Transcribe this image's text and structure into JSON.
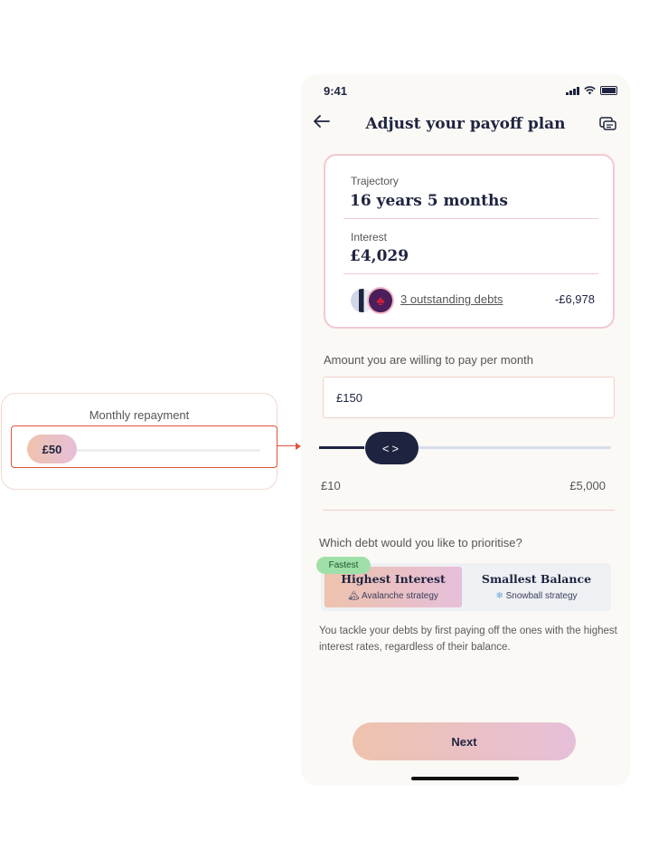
{
  "annotation": {
    "title": "Monthly repayment",
    "pill_value": "£50"
  },
  "status_bar": {
    "time": "9:41"
  },
  "header": {
    "title": "Adjust your payoff plan",
    "back_icon": "arrow-left-icon",
    "chat_icon": "chat-bubbles-icon"
  },
  "summary": {
    "trajectory_label": "Trajectory",
    "trajectory_value": "16 years 5 months",
    "interest_label": "Interest",
    "interest_value": "£4,029",
    "debts_link": "3 outstanding debts",
    "debts_amount": "-£6,978"
  },
  "amount": {
    "label": "Amount you are willing to pay per month",
    "value": "£150"
  },
  "slider": {
    "min_label": "£10",
    "max_label": "£5,000",
    "knob_glyph": "<>"
  },
  "prioritise": {
    "label": "Which debt would you like to prioritise?",
    "badge": "Fastest",
    "options": [
      {
        "title": "Highest Interest",
        "subtitle": "Avalanche strategy",
        "icon": "🏔",
        "selected": true
      },
      {
        "title": "Smallest Balance",
        "subtitle": "Snowball strategy",
        "icon": "❄",
        "selected": false
      }
    ],
    "description": "You tackle your debts by first paying off the ones with the highest interest rates, regardless of their balance."
  },
  "next_button": "Next",
  "colors": {
    "navy": "#1e2440",
    "accent_gradient_start": "#eec2ad",
    "accent_gradient_end": "#e6bfd9",
    "badge_green": "#9fe0a9"
  }
}
